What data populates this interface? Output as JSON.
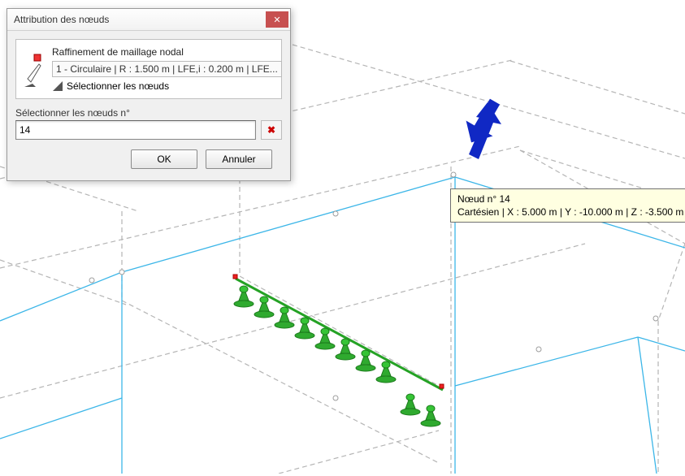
{
  "dialog": {
    "title": "Attribution des nœuds",
    "close_glyph": "✕",
    "refinement_label": "Raffinement de maillage nodal",
    "refinement_value": "1 - Circulaire | R : 1.500 m | LFE,i : 0.200 m | LFE...",
    "select_nodes_label": "Sélectionner les nœuds",
    "section_header": "Sélectionner les nœuds n°",
    "input_value": "14",
    "clear_glyph": "✖",
    "ok_label": "OK",
    "cancel_label": "Annuler"
  },
  "tooltip": {
    "line1": "Nœud n° 14",
    "line2": "Cartésien | X : 5.000 m | Y : -10.000 m | Z : -3.500 m"
  }
}
